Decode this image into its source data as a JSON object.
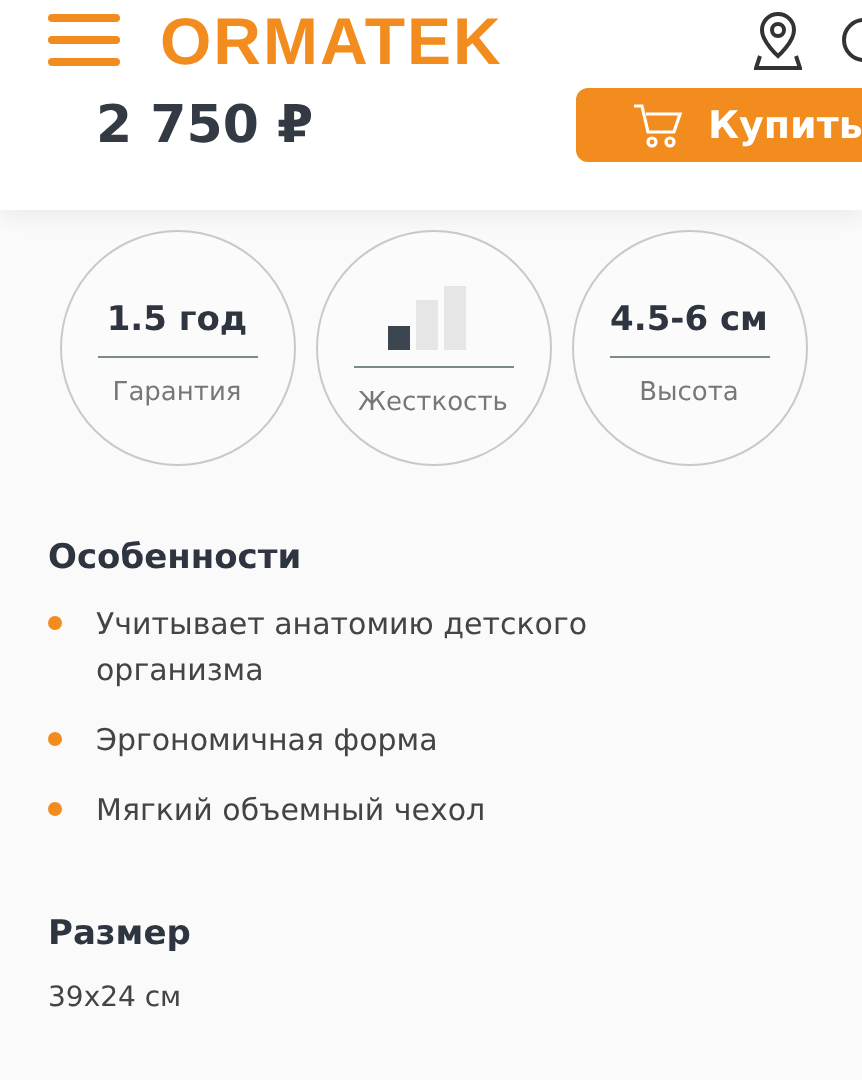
{
  "header": {
    "logo": "ORMATEK",
    "price": "2 750 ₽",
    "buy_button": "Купить"
  },
  "specs": [
    {
      "kind": "text",
      "value": "1.5 год",
      "label": "Гарантия"
    },
    {
      "kind": "bars",
      "bars": [
        {
          "filled": true
        },
        {
          "filled": false
        },
        {
          "filled": false
        }
      ],
      "label": "Жесткость"
    },
    {
      "kind": "text",
      "value": "4.5-6 см",
      "label": "Высота"
    }
  ],
  "features": {
    "title": "Особенности",
    "items": [
      "Учитывает анатомию детского организма",
      "Эргономичная форма",
      "Мягкий объемный чехол"
    ]
  },
  "size": {
    "title": "Размер",
    "value": "39x24 см"
  }
}
